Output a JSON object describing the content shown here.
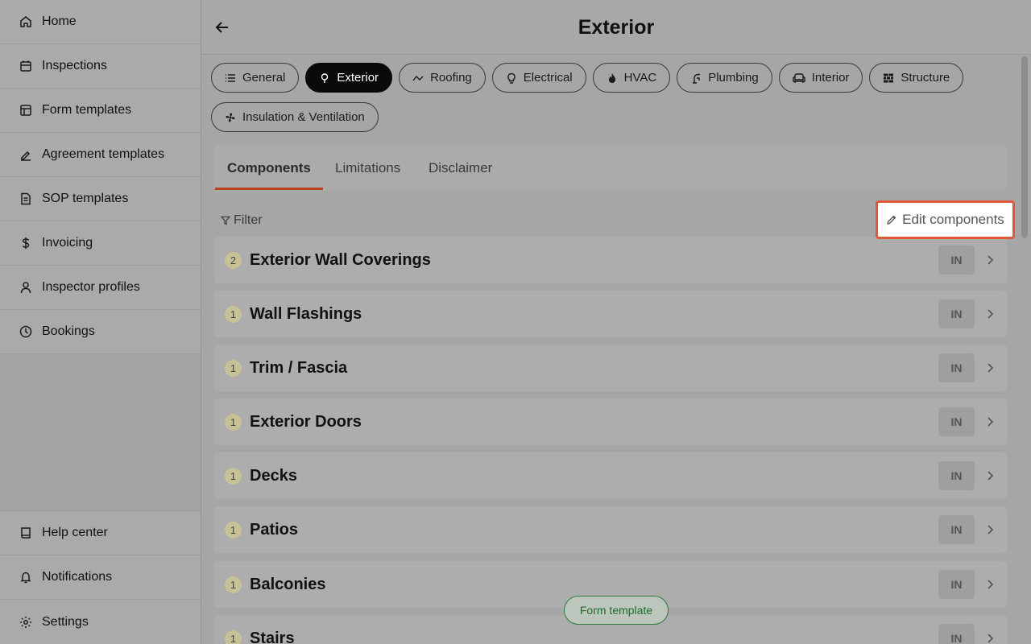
{
  "sidebar": {
    "top_items": [
      {
        "label": "Home",
        "icon": "home-icon"
      },
      {
        "label": "Inspections",
        "icon": "calendar-icon"
      },
      {
        "label": "Form templates",
        "icon": "layout-icon"
      },
      {
        "label": "Agreement templates",
        "icon": "signature-icon"
      },
      {
        "label": "SOP templates",
        "icon": "document-icon"
      },
      {
        "label": "Invoicing",
        "icon": "dollar-icon"
      },
      {
        "label": "Inspector profiles",
        "icon": "user-icon"
      },
      {
        "label": "Bookings",
        "icon": "clock-icon"
      }
    ],
    "bottom_items": [
      {
        "label": "Help center",
        "icon": "book-icon"
      },
      {
        "label": "Notifications",
        "icon": "bell-icon"
      },
      {
        "label": "Settings",
        "icon": "gear-icon"
      }
    ]
  },
  "header": {
    "title": "Exterior"
  },
  "categories": [
    {
      "label": "General",
      "icon": "list-icon",
      "active": false
    },
    {
      "label": "Exterior",
      "icon": "tree-icon",
      "active": true
    },
    {
      "label": "Roofing",
      "icon": "roof-icon",
      "active": false
    },
    {
      "label": "Electrical",
      "icon": "lightbulb-icon",
      "active": false
    },
    {
      "label": "HVAC",
      "icon": "flame-icon",
      "active": false
    },
    {
      "label": "Plumbing",
      "icon": "faucet-icon",
      "active": false
    },
    {
      "label": "Interior",
      "icon": "sofa-icon",
      "active": false
    },
    {
      "label": "Structure",
      "icon": "brick-icon",
      "active": false
    },
    {
      "label": "Insulation & Ventilation",
      "icon": "fan-icon",
      "active": false
    }
  ],
  "tabs": [
    {
      "label": "Components",
      "active": true
    },
    {
      "label": "Limitations",
      "active": false
    },
    {
      "label": "Disclaimer",
      "active": false
    }
  ],
  "toolbar": {
    "filter_label": "Filter",
    "edit_label": "Edit components"
  },
  "components": [
    {
      "count": "2",
      "name": "Exterior Wall Coverings",
      "status": "IN"
    },
    {
      "count": "1",
      "name": "Wall Flashings",
      "status": "IN"
    },
    {
      "count": "1",
      "name": "Trim / Fascia",
      "status": "IN"
    },
    {
      "count": "1",
      "name": "Exterior Doors",
      "status": "IN"
    },
    {
      "count": "1",
      "name": "Decks",
      "status": "IN"
    },
    {
      "count": "1",
      "name": "Patios",
      "status": "IN"
    },
    {
      "count": "1",
      "name": "Balconies",
      "status": "IN"
    },
    {
      "count": "1",
      "name": "Stairs",
      "status": "IN"
    }
  ],
  "floating": {
    "label": "Form template"
  },
  "colors": {
    "accent_underline": "#b8441f",
    "highlight_border": "#e0573a",
    "pill_green": "#1e6b2e"
  }
}
